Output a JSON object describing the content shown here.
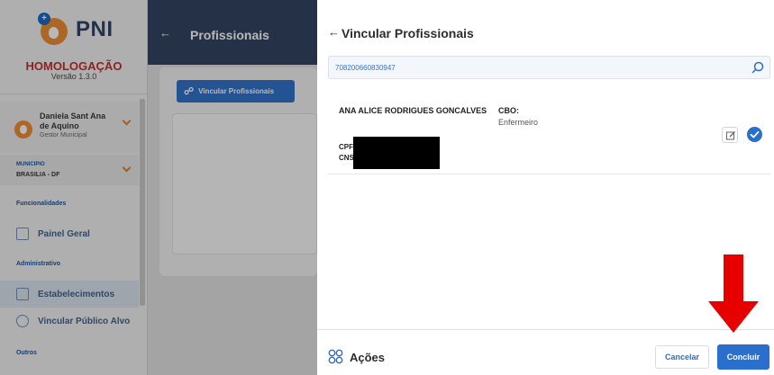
{
  "sidebar": {
    "logo_badge": "+",
    "logo_text": "PNI",
    "environment": "HOMOLOGAÇÃO",
    "version": "Versão 1.3.0",
    "user_name": "Daniela Sant Ana de Aquino",
    "user_role": "Gestor Municipal",
    "municipio_label": "MUNICIPIO",
    "municipio_value": "BRASILIA - DF",
    "section_funcionalidades": "Funcionalidades",
    "item_painel": "Painel Geral",
    "section_administrativo": "Administrativo",
    "item_estabelecimentos": "Estabelecimentos",
    "item_vincular_publico": "Vincular Público Alvo",
    "section_outros": "Outros"
  },
  "page": {
    "back_glyph": "←",
    "title": "Profissionais",
    "vincular_button": "Vincular Profissionais"
  },
  "drawer": {
    "back_glyph": "←",
    "title": "Vincular Profissionais",
    "search_value": "708200660830947",
    "professional": {
      "name": "ANA ALICE RODRIGUES GONCALVES",
      "cbo_label": "CBO:",
      "cbo_value": "Enfermeiro",
      "cpf_label": "CPF",
      "cns_label": "CNS"
    },
    "footer_label": "Ações",
    "cancel_label": "Cancelar",
    "concluir_label": "Concluir"
  },
  "colors": {
    "primary": "#2a6fcb",
    "header": "#2b3e5c",
    "environment": "#c62828",
    "brand_orange": "#f08a2c",
    "annotation_arrow": "#e60000"
  },
  "icons": {
    "search": "search-icon",
    "edit": "edit-icon",
    "check": "check-circle-icon",
    "actions": "grid-icon",
    "link": "link-icon"
  }
}
